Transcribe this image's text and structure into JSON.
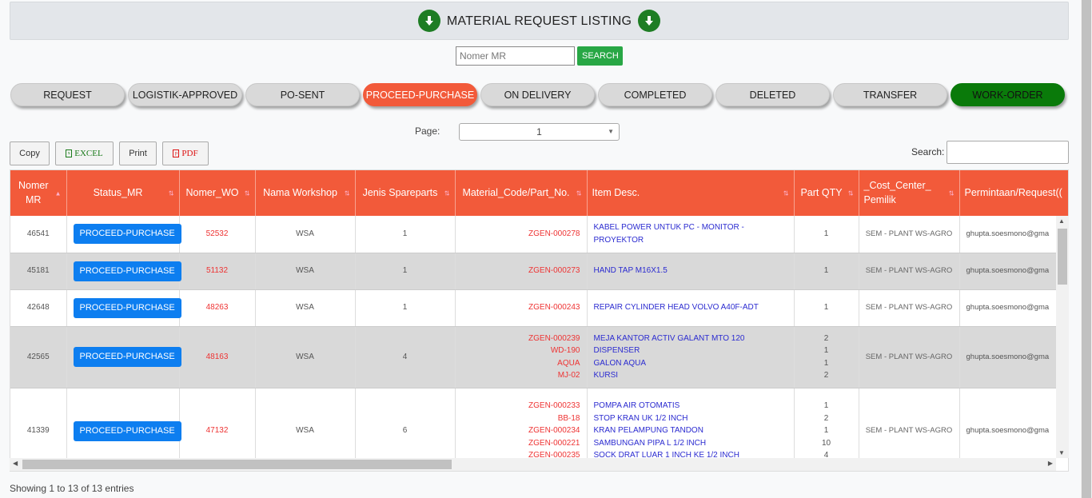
{
  "header": {
    "title": "MATERIAL REQUEST LISTING"
  },
  "search_mr": {
    "placeholder": "Nomer MR",
    "button": "SEARCH"
  },
  "tabs": [
    "REQUEST",
    "LOGISTIK-APPROVED",
    "PO-SENT",
    "PROCEED-PURCHASE",
    "ON DELIVERY",
    "COMPLETED",
    "DELETED",
    "TRANSFER",
    "WORK-ORDER"
  ],
  "active_tab": "PROCEED-PURCHASE",
  "pagination": {
    "label": "Page:",
    "value": "1"
  },
  "export_buttons": {
    "copy": "Copy",
    "excel": "EXCEL",
    "print": "Print",
    "pdf": "PDF"
  },
  "table_search_label": "Search:",
  "columns": [
    "Nomer MR",
    "Status_MR",
    "Nomer_WO",
    "Nama Workshop",
    "Jenis Spareparts",
    "Material_Code/Part_No.",
    "Item Desc.",
    "Part QTY",
    "_Cost_Center_ Pemilik",
    "Permintaan/Request(("
  ],
  "rows": [
    {
      "mr": "46541",
      "status": "PROCEED-PURCHASE",
      "wo": "52532",
      "workshop": "WSA",
      "jenis": "1",
      "codes": [
        "ZGEN-000278"
      ],
      "items": [
        "KABEL POWER UNTUK PC - MONITOR - PROYEKTOR"
      ],
      "qty": [
        "1"
      ],
      "cost_center": "SEM - PLANT WS-AGRO",
      "request": "ghupta.soesmono@gma"
    },
    {
      "mr": "45181",
      "status": "PROCEED-PURCHASE",
      "wo": "51132",
      "workshop": "WSA",
      "jenis": "1",
      "codes": [
        "ZGEN-000273"
      ],
      "items": [
        "HAND TAP M16X1.5"
      ],
      "qty": [
        "1"
      ],
      "cost_center": "SEM - PLANT WS-AGRO",
      "request": "ghupta.soesmono@gma"
    },
    {
      "mr": "42648",
      "status": "PROCEED-PURCHASE",
      "wo": "48263",
      "workshop": "WSA",
      "jenis": "1",
      "codes": [
        "ZGEN-000243"
      ],
      "items": [
        "REPAIR CYLINDER HEAD VOLVO A40F-ADT"
      ],
      "qty": [
        "1"
      ],
      "cost_center": "SEM - PLANT WS-AGRO",
      "request": "ghupta.soesmono@gma"
    },
    {
      "mr": "42565",
      "status": "PROCEED-PURCHASE",
      "wo": "48163",
      "workshop": "WSA",
      "jenis": "4",
      "codes": [
        "ZGEN-000239",
        "WD-190",
        "AQUA",
        "MJ-02"
      ],
      "items": [
        "MEJA KANTOR ACTIV GALANT MTO 120",
        "DISPENSER",
        "GALON AQUA",
        "KURSI"
      ],
      "qty": [
        "2",
        "1",
        "1",
        "2"
      ],
      "cost_center": "SEM - PLANT WS-AGRO",
      "request": "ghupta.soesmono@gma"
    },
    {
      "mr": "41339",
      "status": "PROCEED-PURCHASE",
      "wo": "47132",
      "workshop": "WSA",
      "jenis": "6",
      "codes": [
        "ZGEN-000233",
        "BB-18",
        "ZGEN-000234",
        "ZGEN-000221",
        "ZGEN-000235"
      ],
      "items": [
        "POMPA AIR OTOMATIS",
        "STOP KRAN UK 1/2 INCH",
        "KRAN PELAMPUNG TANDON",
        "SAMBUNGAN PIPA L 1/2 INCH",
        "SOCK DRAT LUAR 1 INCH KE 1/2 INCH"
      ],
      "qty": [
        "1",
        "2",
        "1",
        "10",
        "4"
      ],
      "cost_center": "SEM - PLANT WS-AGRO",
      "request": "ghupta.soesmono@gma"
    }
  ],
  "footer": {
    "info": "Showing 1 to 13 of 13 entries"
  },
  "colors": {
    "accent": "#f25a3a",
    "status_button": "#0d7ef0",
    "search_button": "#28a745",
    "work_order_tab": "#0a7a0a",
    "header_arrow": "#1e7d24"
  },
  "icons": {
    "header_left": "arrow-down-circle-icon",
    "header_right": "arrow-down-circle-icon"
  }
}
